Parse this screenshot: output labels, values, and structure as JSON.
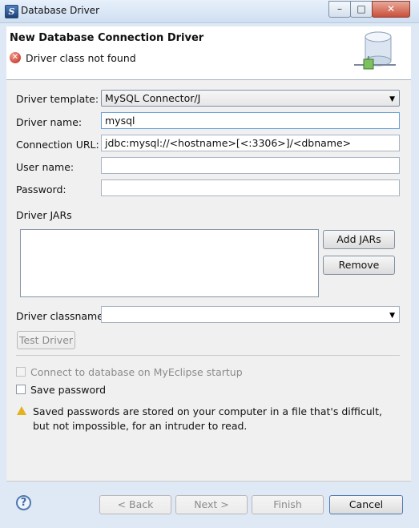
{
  "window": {
    "title": "Database Driver"
  },
  "header": {
    "title": "New Database Connection Driver",
    "message": "Driver class not found"
  },
  "form": {
    "driver_template_label": "Driver template:",
    "driver_template_value": "MySQL Connector/J",
    "driver_name_label": "Driver name:",
    "driver_name_value": "mysql",
    "connection_url_label": "Connection URL:",
    "connection_url_value": "jdbc:mysql://<hostname>[<:3306>]/<dbname>",
    "user_name_label": "User name:",
    "user_name_value": "",
    "password_label": "Password:",
    "password_value": ""
  },
  "jars": {
    "section_label": "Driver JARs",
    "add_button": "Add JARs",
    "remove_button": "Remove",
    "classname_label": "Driver classname:",
    "classname_value": "",
    "test_button": "Test Driver"
  },
  "options": {
    "connect_on_startup": "Connect to database on MyEclipse startup",
    "save_password": "Save password",
    "warning": "Saved passwords are stored on your computer in a file that's difficult, but not impossible, for an intruder to read."
  },
  "footer": {
    "back": "< Back",
    "next": "Next >",
    "finish": "Finish",
    "cancel": "Cancel"
  }
}
